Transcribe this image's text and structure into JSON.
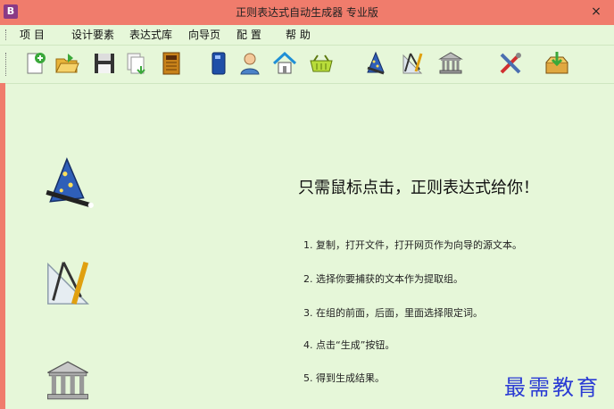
{
  "window": {
    "title": "正则表达式自动生成器 专业版",
    "app_icon_glyph": "B",
    "close_glyph": "×"
  },
  "menu": {
    "items": [
      "项 目",
      "设计要素",
      "表达式库",
      "向导页",
      "配 置",
      "帮 助"
    ]
  },
  "toolbar": {
    "icons": [
      "new-file-icon",
      "open-folder-icon",
      "save-icon",
      "export-icon",
      "close-book-icon",
      "manual-book-icon",
      "user-icon",
      "home-icon",
      "basket-icon",
      "wizard-icon",
      "compass-ruler-icon",
      "library-icon",
      "tools-icon",
      "download-icon"
    ]
  },
  "main": {
    "headline": "只需鼠标点击，正则表达式给你！",
    "steps": [
      "1. 复制，打开文件，打开网页作为向导的源文本。",
      "2. 选择你要捕获的文本作为提取组。",
      "3. 在组的前面，后面，里面选择限定词。",
      "4. 点击“生成”按钮。",
      "5. 得到生成结果。"
    ]
  },
  "watermark": "最需教育"
}
